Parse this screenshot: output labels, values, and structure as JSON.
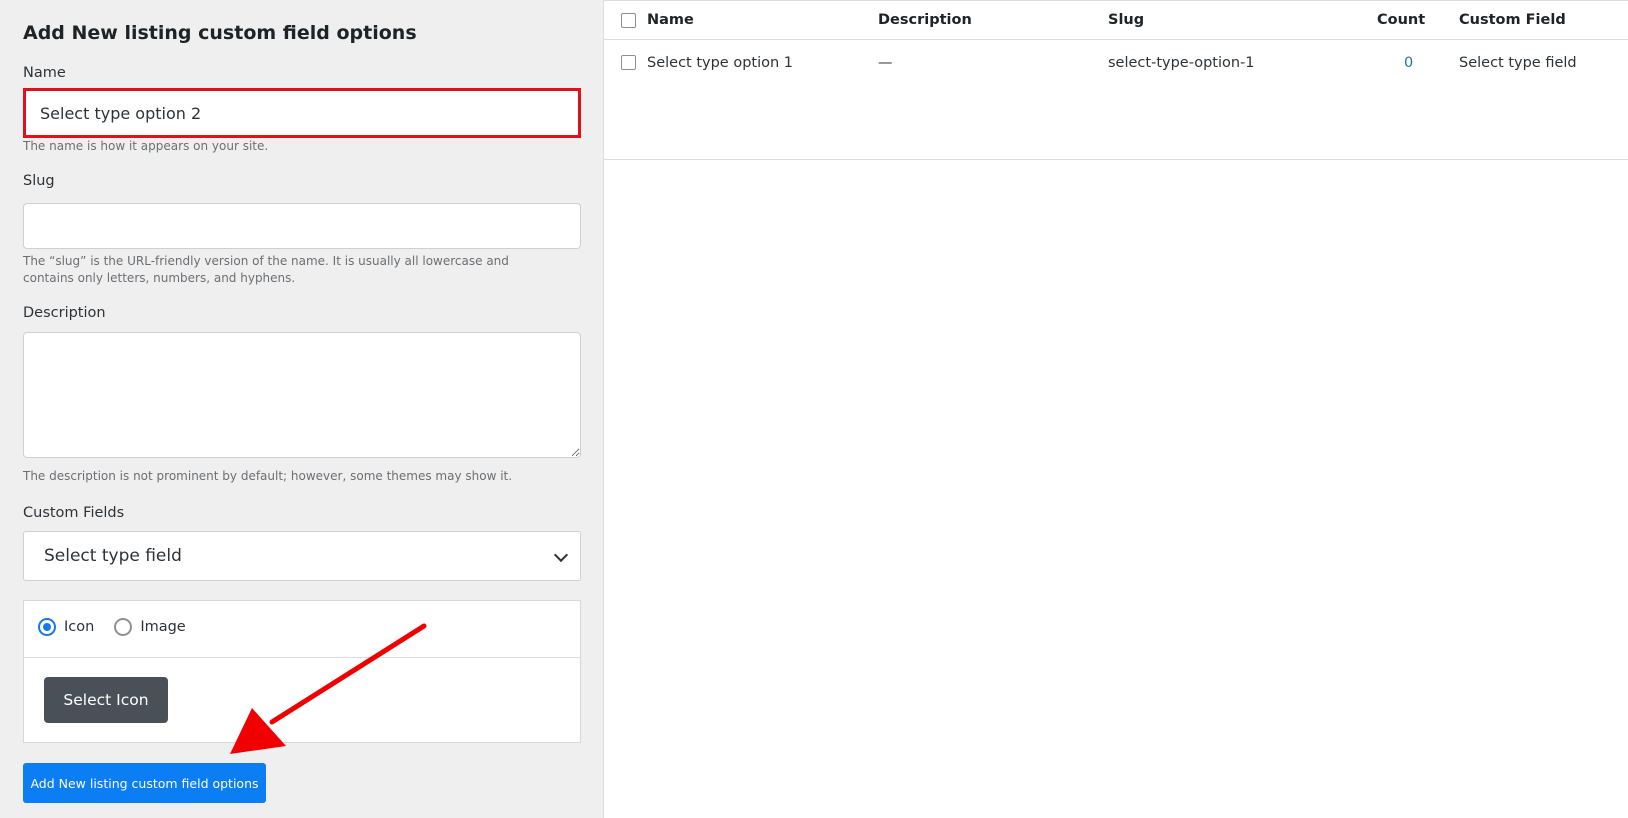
{
  "form": {
    "title": "Add New listing custom field options",
    "name_label": "Name",
    "name_value": "Select type option 2",
    "name_help": "The name is how it appears on your site.",
    "slug_label": "Slug",
    "slug_value": "",
    "slug_help": "The “slug” is the URL-friendly version of the name. It is usually all lowercase and contains only letters, numbers, and hyphens.",
    "description_label": "Description",
    "description_value": "",
    "description_help": "The description is not prominent by default; however, some themes may show it.",
    "custom_fields_label": "Custom Fields",
    "custom_fields_selected": "Select type field",
    "radio_icon_label": "Icon",
    "radio_image_label": "Image",
    "radio_selected": "Icon",
    "select_icon_button": "Select Icon",
    "submit_button": "Add New listing custom field options"
  },
  "table": {
    "headers": [
      "Name",
      "Description",
      "Slug",
      "Count",
      "Custom Field"
    ],
    "rows": [
      {
        "name": "Select type option 1",
        "description": "—",
        "slug": "select-type-option-1",
        "count": "0",
        "custom_field": "Select type field"
      }
    ]
  },
  "annotations": {
    "highlight_color": "#e1111b",
    "arrow_color": "#f00000",
    "highlight_icon": "highlight-box",
    "arrow_icon": "red-arrow"
  },
  "colors": {
    "primary_button": "#0b7ef3",
    "secondary_button": "#495057",
    "radio_checked": "#1977e6",
    "link": "#2271b1"
  }
}
